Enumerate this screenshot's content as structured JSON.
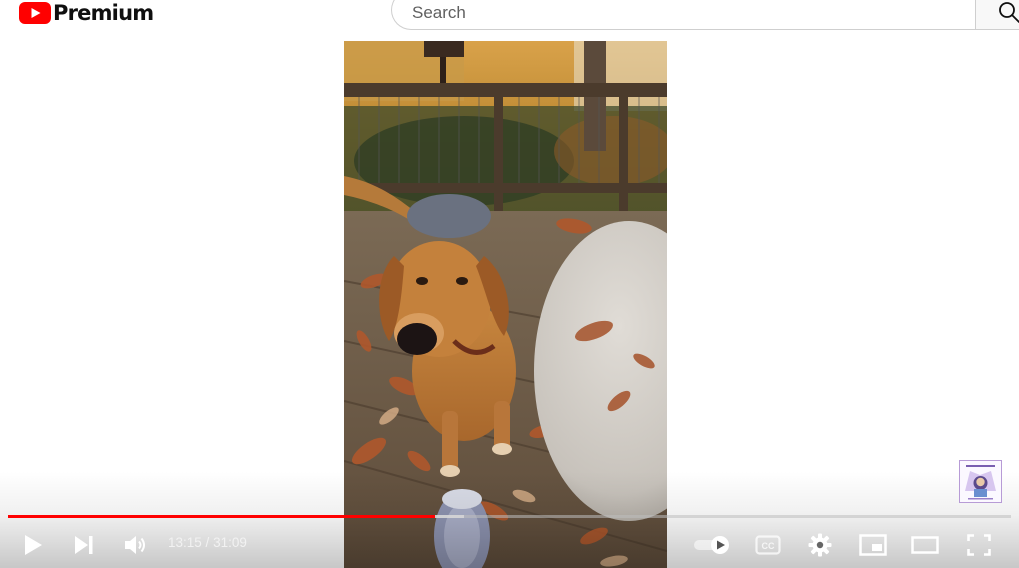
{
  "masthead": {
    "logo_text": "Premium",
    "brand_color": "#ff0000",
    "logo_icon": "youtube-play-logo-icon",
    "search": {
      "placeholder": "Search",
      "value": "",
      "icon": "search-icon"
    }
  },
  "player": {
    "time": {
      "current": "13:15",
      "separator": " / ",
      "duration": "31:09"
    },
    "progress": {
      "played_fraction": 0.4254,
      "loaded_fraction": 0.455,
      "played_color": "#ff0000"
    },
    "controls": {
      "left": [
        "play-icon",
        "next-icon",
        "volume-icon"
      ],
      "right": [
        "autoplay-toggle-icon",
        "subtitles-icon",
        "settings-icon",
        "miniplayer-icon",
        "theater-mode-icon",
        "fullscreen-icon"
      ]
    },
    "subtitles_label": "CC"
  }
}
